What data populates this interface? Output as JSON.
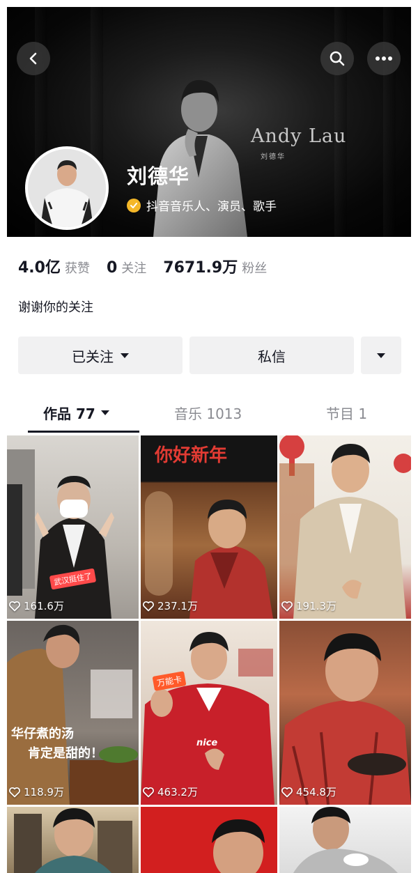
{
  "profile": {
    "name": "刘德华",
    "verification": "抖音音乐人、演员、歌手",
    "brand_en": "Andy Lau",
    "brand_cn": "刘德华",
    "bio": "谢谢你的关注"
  },
  "stats": [
    {
      "value": "4.0亿",
      "label": "获赞"
    },
    {
      "value": "0",
      "label": "关注"
    },
    {
      "value": "7671.9万",
      "label": "粉丝"
    }
  ],
  "actions": {
    "follow_label": "已关注",
    "message_label": "私信"
  },
  "tabs": [
    {
      "label": "作品 77",
      "active": true
    },
    {
      "label": "音乐 1013",
      "active": false
    },
    {
      "label": "节目 1",
      "active": false
    }
  ],
  "videos": [
    {
      "likes": "161.6万",
      "caption": "武汉挺住了"
    },
    {
      "likes": "237.1万",
      "caption": "你好新年"
    },
    {
      "likes": "191.3万"
    },
    {
      "likes": "118.9万",
      "caption_line1": "华仔煮的汤",
      "caption_line2": "肯定是甜的！"
    },
    {
      "likes": "463.2万",
      "tag": "万能卡",
      "sticker": "nice"
    },
    {
      "likes": "454.8万"
    },
    {},
    {},
    {}
  ],
  "icons": {
    "back": "chevron-left-icon",
    "search": "search-icon",
    "more": "more-dots-icon",
    "verified": "verified-badge-icon",
    "like": "heart-outline-icon",
    "dropdown": "triangle-down-icon"
  },
  "colors": {
    "primary_text": "#161823",
    "secondary_text": "#8a8b91",
    "button_bg": "#f1f1f2",
    "verified": "#f4b728"
  }
}
